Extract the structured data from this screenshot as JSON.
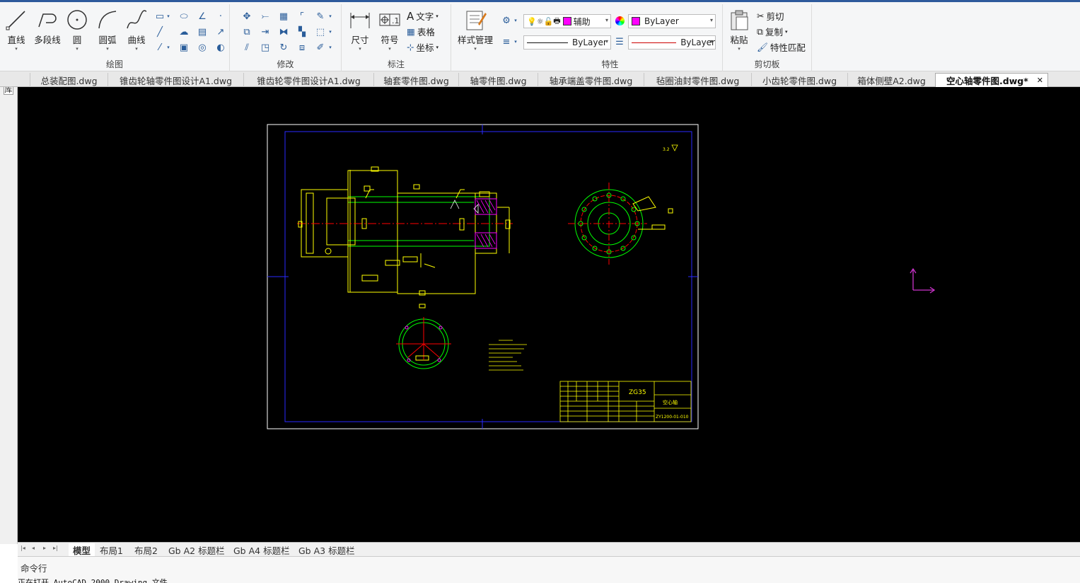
{
  "ribbon": {
    "draw_panel": {
      "label": "绘图",
      "line": "直线",
      "polyline": "多段线",
      "circle": "圆",
      "arc": "圆弧",
      "spline": "曲线"
    },
    "modify_panel": {
      "label": "修改"
    },
    "annotate_panel": {
      "label": "标注",
      "dimension": "尺寸",
      "symbol": "符号",
      "text": "文字",
      "table": "表格",
      "coordinate": "坐标"
    },
    "style_panel": {
      "style_manager": "样式管理"
    },
    "properties_panel": {
      "label": "特性",
      "layer_name": "辅助",
      "color_value": "ByLayer",
      "linetype_value": "ByLayer",
      "lineweight_value": "ByLayer"
    },
    "clipboard_panel": {
      "label": "剪切板",
      "paste": "粘贴",
      "cut": "剪切",
      "copy": "复制",
      "match_prop": "特性匹配"
    }
  },
  "colors": {
    "accent": "#2e5a9c",
    "layer_color": "#ff00ff",
    "canvas_bg": "#000000",
    "drawing_yellow": "#ffff00",
    "drawing_green": "#00ff00",
    "drawing_red": "#ff0000",
    "drawing_blue": "#0000ff",
    "drawing_magenta": "#ff00ff",
    "ucs_icon": "#cc33cc"
  },
  "doc_tabs": [
    {
      "label": "总装配图.dwg"
    },
    {
      "label": "锥齿轮轴零件图设计A1.dwg"
    },
    {
      "label": "锥齿轮零件图设计A1.dwg"
    },
    {
      "label": "轴套零件图.dwg"
    },
    {
      "label": "轴零件图.dwg"
    },
    {
      "label": "轴承端盖零件图.dwg"
    },
    {
      "label": "毡圈油封零件图.dwg"
    },
    {
      "label": "小齿轮零件图.dwg"
    },
    {
      "label": "箱体侧壁A2.dwg"
    },
    {
      "label": "空心轴零件图.dwg*"
    }
  ],
  "left_panel_label": "图库",
  "drawing": {
    "material": "ZG35",
    "part_name": "空心轴",
    "drawing_no": "ZY1200-01-010"
  },
  "layout_tabs": [
    "模型",
    "布局1",
    "布局2",
    "Gb A2 标题栏",
    "Gb A4 标题栏",
    "Gb A3 标题栏"
  ],
  "command": {
    "label": "命令行",
    "history": "正在打开 AutoCAD 2000 Drawing 文件"
  }
}
